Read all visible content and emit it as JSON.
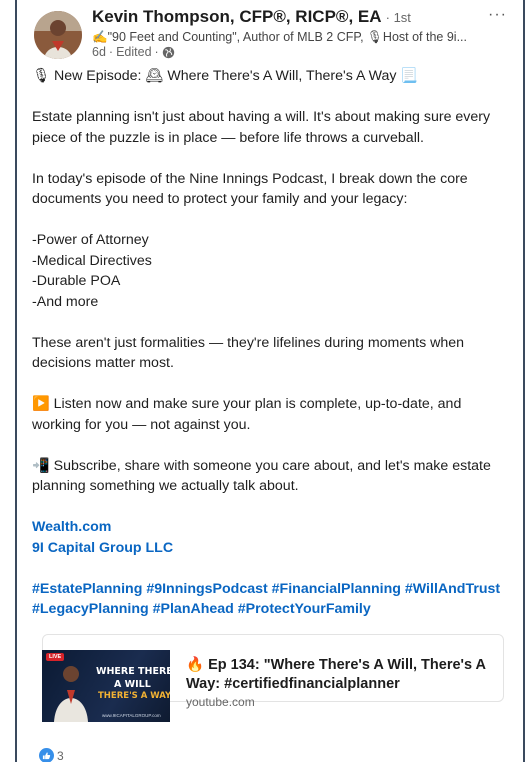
{
  "author": {
    "name": "Kevin Thompson, CFP®, RICP®, EA",
    "degree": "· 1st",
    "headline": "✍\"90 Feet and Counting\", Author of MLB 2 CFP, 🎙Host of the 9i...",
    "time": "6d",
    "edited": "Edited",
    "visibility_icon": "globe-icon"
  },
  "more_label": "···",
  "post": {
    "line1": "🎙 New Episode: 🕰 Where There's A Will, There's A Way 📃",
    "para1": "Estate planning isn't just about having a will. It's about making sure every piece of the puzzle is in place — before life throws a curveball.",
    "para2": "In today's episode of the Nine Innings Podcast, I break down the core documents you need to protect your family and your legacy:",
    "list": [
      "-Power of Attorney",
      "-Medical Directives",
      "-Durable POA",
      "-And more"
    ],
    "para3": "These aren't just formalities — they're lifelines during moments when decisions matter most.",
    "para4": "▶️ Listen now and make sure your plan is complete, up-to-date, and working for you — not against you.",
    "para5": "📲 Subscribe, share with someone you care about, and let's make estate planning something we actually talk about.",
    "mentions": [
      "Wealth.com",
      "9I Capital Group LLC"
    ],
    "hashtags_line1": "#EstatePlanning #9InningsPodcast #FinancialPlanning #WillAndTrust",
    "hashtags_line2": "#LegacyPlanning #PlanAhead #ProtectYourFamily"
  },
  "preview": {
    "thumb_live": "LIVE",
    "thumb_line1": "WHERE THERE'S",
    "thumb_line2": "A WILL",
    "thumb_line3": "THERE'S A WAY",
    "thumb_url": "www.9ICAPITALGROUP.com",
    "title": "🔥 Ep 134: \"Where There's A Will, There's A Way: #certifiedfinancialplanner",
    "domain": "youtube.com"
  },
  "reactions": {
    "count": "3",
    "icon": "like-icon"
  },
  "colors": {
    "link": "#0a66c2",
    "like": "#378fe9",
    "border": "#3a4a5e"
  }
}
